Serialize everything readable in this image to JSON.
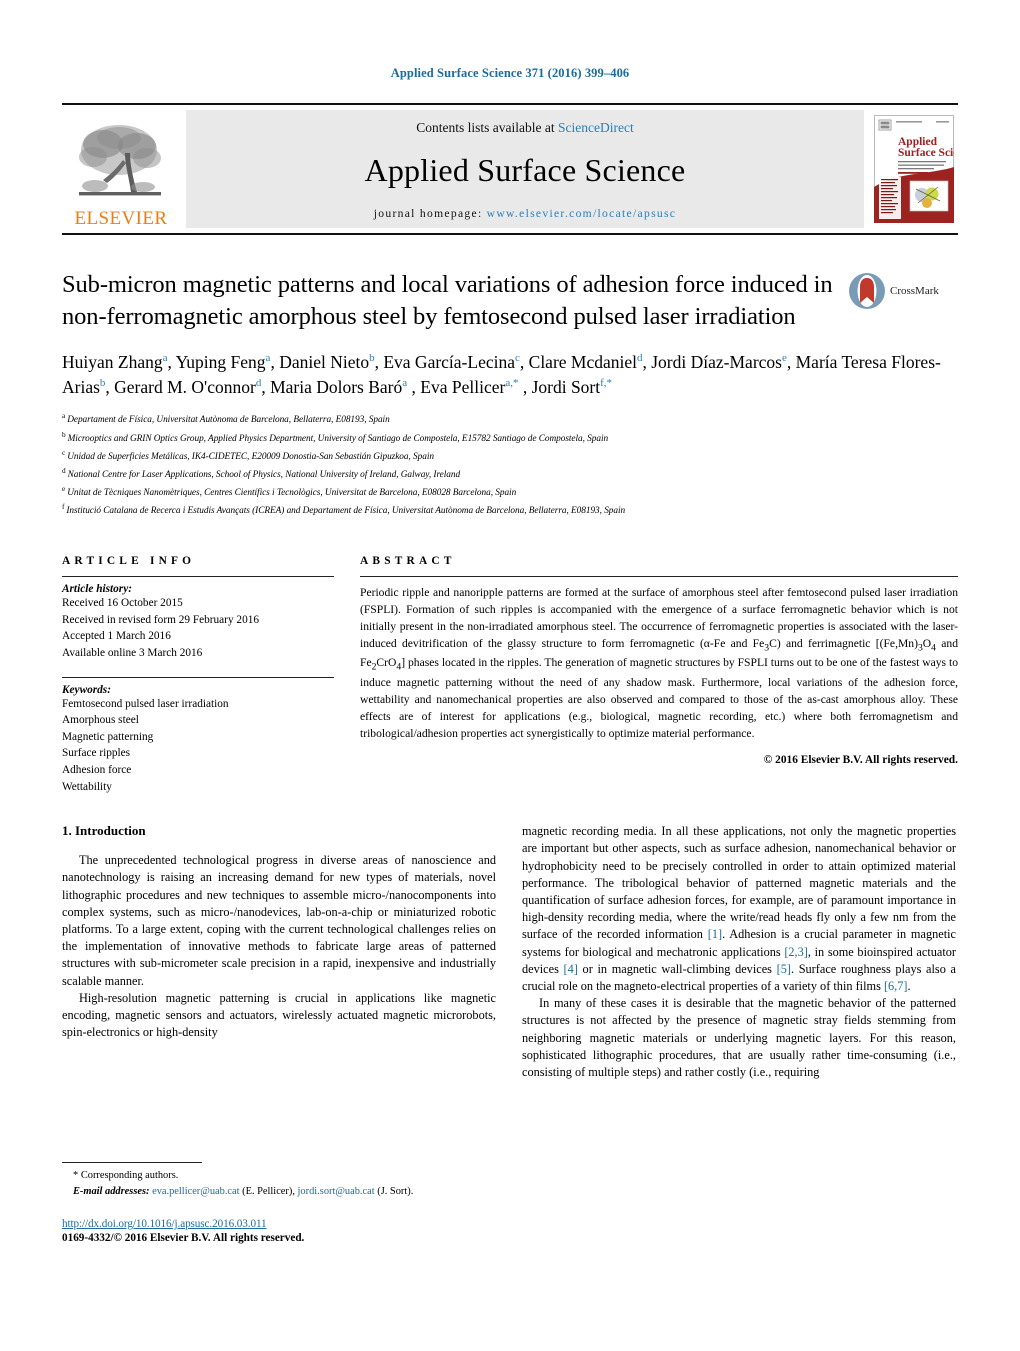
{
  "running_head": "Applied Surface Science 371 (2016) 399–406",
  "masthead": {
    "publisher_logo_text": "ELSEVIER",
    "contents_prefix": "Contents lists available at",
    "contents_link": "ScienceDirect",
    "journal_name": "Applied Surface Science",
    "homepage_prefix": "journal homepage:",
    "homepage_url": "www.elsevier.com/locate/apsusc",
    "cover_title_line1": "Applied",
    "cover_title_line2": "Surface Science"
  },
  "article": {
    "title": "Sub-micron magnetic patterns and local variations of adhesion force induced in non-ferromagnetic amorphous steel by femtosecond pulsed laser irradiation",
    "crossmark_label": "CrossMark",
    "authors": [
      {
        "name": "Huiyan Zhang",
        "marks": "a",
        "sep": ", "
      },
      {
        "name": "Yuping Feng",
        "marks": "a",
        "sep": ", "
      },
      {
        "name": "Daniel Nieto",
        "marks": "b",
        "sep": ", "
      },
      {
        "name": "Eva García-Lecina",
        "marks": "c",
        "sep": ", "
      },
      {
        "name": "Clare Mcdaniel",
        "marks": "d",
        "sep": ", "
      },
      {
        "name": "Jordi Díaz-Marcos",
        "marks": "e",
        "sep": ", "
      },
      {
        "name": "María Teresa Flores-Arias",
        "marks": "b",
        "sep": ", "
      },
      {
        "name": "Gerard M. O'connor",
        "marks": "d",
        "sep": ", "
      },
      {
        "name": "Maria Dolors Baró",
        "marks": "a",
        "sep": ""
      },
      {
        "name": ", Eva Pellicer",
        "marks": "a,*",
        "sep": ""
      },
      {
        "name": ", Jordi Sort",
        "marks": "f,*",
        "sep": ""
      }
    ],
    "affiliations": [
      {
        "mark": "a",
        "text": "Departament de Física, Universitat Autònoma de Barcelona, Bellaterra, E08193, Spain"
      },
      {
        "mark": "b",
        "text": "Microoptics and GRIN Optics Group, Applied Physics Department, University of Santiago de Compostela, E15782 Santiago de Compostela, Spain"
      },
      {
        "mark": "c",
        "text": "Unidad de Superficies Metálicas, IK4-CIDETEC, E20009 Donostia-San Sebastián Gipuzkoa, Spain"
      },
      {
        "mark": "d",
        "text": "National Centre for Laser Applications, School of Physics, National University of Ireland, Galway, Ireland"
      },
      {
        "mark": "e",
        "text": "Unitat de Tècniques Nanomètriques, Centres Científics i Tecnològics, Universitat de Barcelona, E08028 Barcelona, Spain"
      },
      {
        "mark": "f",
        "text": "Institució Catalana de Recerca i Estudis Avançats (ICREA) and Departament de Física, Universitat Autònoma de Barcelona, Bellaterra, E08193, Spain"
      }
    ]
  },
  "article_info": {
    "heading": "ARTICLE INFO",
    "history_label": "Article history:",
    "history": [
      "Received 16 October 2015",
      "Received in revised form 29 February 2016",
      "Accepted 1 March 2016",
      "Available online 3 March 2016"
    ],
    "keywords_label": "Keywords:",
    "keywords": [
      "Femtosecond pulsed laser irradiation",
      "Amorphous steel",
      "Magnetic patterning",
      "Surface ripples",
      "Adhesion force",
      "Wettability"
    ]
  },
  "abstract": {
    "heading": "ABSTRACT",
    "paragraph_part1": "Periodic ripple and nanoripple patterns are formed at the surface of amorphous steel after femtosecond pulsed laser irradiation (FSPLI). Formation of such ripples is accompanied with the emergence of a surface ferromagnetic behavior which is not initially present in the non-irradiated amorphous steel. The occurrence of ferromagnetic properties is associated with the laser-induced devitrification of the glassy structure to form ferromagnetic (α-Fe and Fe",
    "sub1": "3",
    "mid1": "C) and ferrimagnetic [(Fe,Mn)",
    "sub2": "3",
    "mid2": "O",
    "sub3": "4",
    "mid3": " and Fe",
    "sub4": "2",
    "mid4": "CrO",
    "sub5": "4",
    "paragraph_part2": "] phases located in the ripples. The generation of magnetic structures by FSPLI turns out to be one of the fastest ways to induce magnetic patterning without the need of any shadow mask. Furthermore, local variations of the adhesion force, wettability and nanomechanical properties are also observed and compared to those of the as-cast amorphous alloy. These effects are of interest for applications (e.g., biological, magnetic recording, etc.) where both ferromagnetism and tribological/adhesion properties act synergistically to optimize material performance.",
    "copyright": "© 2016 Elsevier B.V. All rights reserved."
  },
  "body": {
    "section_heading": "1. Introduction",
    "left_paragraphs": [
      "The unprecedented technological progress in diverse areas of nanoscience and nanotechnology is raising an increasing demand for new types of materials, novel lithographic procedures and new techniques to assemble micro-/nanocomponents into complex systems, such as micro-/nanodevices, lab-on-a-chip or miniaturized robotic platforms. To a large extent, coping with the current technological challenges relies on the implementation of innovative methods to fabricate large areas of patterned structures with sub-micrometer scale precision in a rapid, inexpensive and industrially scalable manner.",
      "High-resolution magnetic patterning is crucial in applications like magnetic encoding, magnetic sensors and actuators, wirelessly actuated magnetic microrobots, spin-electronics or high-density"
    ],
    "right_para1_a": "magnetic recording media. In all these applications, not only the magnetic properties are important but other aspects, such as surface adhesion, nanomechanical behavior or hydrophobicity need to be precisely controlled in order to attain optimized material performance. The tribological behavior of patterned magnetic materials and the quantification of surface adhesion forces, for example, are of paramount importance in high-density recording media, where the write/read heads fly only a few nm from the surface of the recorded information ",
    "ref1": "[1]",
    "right_para1_b": ". Adhesion is a crucial parameter in magnetic systems for biological and mechatronic applications ",
    "ref2": "[2,3]",
    "right_para1_c": ", in some bioinspired actuator devices ",
    "ref3": "[4]",
    "right_para1_d": " or in magnetic wall-climbing devices ",
    "ref4": "[5]",
    "right_para1_e": ". Surface roughness plays also a crucial role on the magneto-electrical properties of a variety of thin films ",
    "ref5": "[6,7]",
    "right_para1_f": ".",
    "right_para2": "In many of these cases it is desirable that the magnetic behavior of the patterned structures is not affected by the presence of magnetic stray fields stemming from neighboring magnetic materials or underlying magnetic layers. For this reason, sophisticated lithographic procedures, that are usually rather time-consuming (i.e., consisting of multiple steps) and rather costly (i.e., requiring"
  },
  "footer": {
    "corresponding_mark": "*",
    "corresponding_label": "Corresponding authors.",
    "email_label": "E-mail addresses:",
    "email1": "eva.pellicer@uab.cat",
    "email1_who": " (E. Pellicer), ",
    "email2": "jordi.sort@uab.cat",
    "email2_who": " (J. Sort).",
    "doi": "http://dx.doi.org/10.1016/j.apsusc.2016.03.011",
    "issn": "0169-4332/© 2016 Elsevier B.V. All rights reserved."
  },
  "colors": {
    "link": "#1a6c9c",
    "elsevier_orange": "#EE7D11",
    "masthead_grey": "#e9e9e9"
  }
}
